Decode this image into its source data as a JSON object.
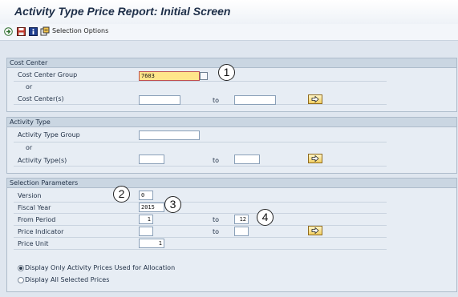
{
  "window": {
    "title": "Activity Type Price Report: Initial Screen"
  },
  "toolbar": {
    "execute_icon": "execute-icon",
    "save_icon": "save-variant-icon",
    "info_icon": "info-icon",
    "selection_options_icon": "selection-options-icon",
    "selection_options_label": "Selection Options"
  },
  "cost_center": {
    "header": "Cost Center",
    "group_label": "Cost Center Group",
    "group_value": "7603",
    "or": "or",
    "centers_label": "Cost Center(s)",
    "centers_from": "",
    "to_label": "to",
    "centers_to": ""
  },
  "activity_type": {
    "header": "Activity Type",
    "group_label": "Activity Type Group",
    "group_value": "",
    "or": "or",
    "types_label": "Activity Type(s)",
    "types_from": "",
    "to_label": "to",
    "types_to": ""
  },
  "selection_parameters": {
    "header": "Selection Parameters",
    "version_label": "Version",
    "version_value": "0",
    "fiscal_year_label": "Fiscal Year",
    "fiscal_year_value": "2015",
    "from_period_label": "From Period",
    "from_period_value": "1",
    "to_period_label": "to",
    "to_period_value": "12",
    "price_indicator_label": "Price Indicator",
    "price_indicator_from": "",
    "price_indicator_to_label": "to",
    "price_indicator_to": "",
    "price_unit_label": "Price Unit",
    "price_unit_value": "1",
    "radio_alloc_label": "Display Only Activity Prices Used for Allocation",
    "radio_alloc_selected": true,
    "radio_all_label": "Display All Selected Prices",
    "radio_all_selected": false
  },
  "callouts": [
    "1",
    "2",
    "3",
    "4"
  ],
  "colors": {
    "required_field": "#ffe58a",
    "group_header": "#cad6e2",
    "title": "#1d2e48"
  }
}
